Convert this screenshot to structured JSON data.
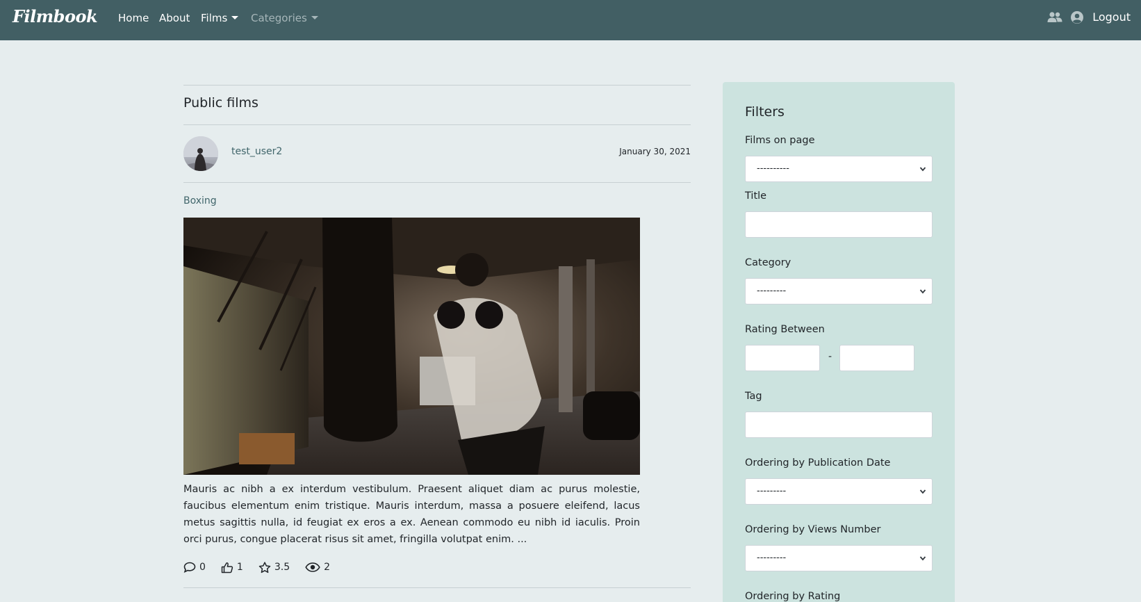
{
  "navbar": {
    "brand": "Filmbook",
    "links": [
      "Home",
      "About",
      "Films",
      "Categories"
    ],
    "logout": "Logout"
  },
  "main": {
    "section_title": "Public films",
    "post": {
      "username": "test_user2",
      "date": "January 30, 2021",
      "category": "Boxing",
      "excerpt": "Mauris ac nibh a ex interdum vestibulum. Praesent aliquet diam ac purus molestie, faucibus elementum enim tristique. Mauris interdum, massa a posuere eleifend, lacus metus sagittis nulla, id feugiat ex eros a ex. Aenean commodo eu nibh id iaculis. Proin orci purus, congue placerat risus sit amet, fringilla volutpat enim. ...",
      "stats": {
        "comments": "0",
        "likes": "1",
        "rating": "3.5",
        "views": "2"
      }
    }
  },
  "filters": {
    "title": "Filters",
    "films_on_page": {
      "label": "Films on page",
      "value": "----------"
    },
    "title_field": {
      "label": "Title",
      "value": ""
    },
    "category": {
      "label": "Category",
      "value": "---------"
    },
    "rating_between": {
      "label": "Rating Between",
      "separator": "-",
      "from": "",
      "to": ""
    },
    "tag": {
      "label": "Tag",
      "value": ""
    },
    "ordering_pub_date": {
      "label": "Ordering by Publication Date",
      "value": "---------"
    },
    "ordering_views": {
      "label": "Ordering by Views Number",
      "value": "---------"
    },
    "ordering_rating": {
      "label": "Ordering by Rating"
    }
  },
  "colors": {
    "navbar": "#425f64",
    "page_background": "#e6edee",
    "filters_background": "#cce3df",
    "link_accent": "#41666b"
  },
  "icons": [
    "users-icon",
    "user-circle-icon",
    "caret-down-icon",
    "comment-icon",
    "thumbs-up-icon",
    "star-icon",
    "eye-icon",
    "chevron-down-icon"
  ]
}
